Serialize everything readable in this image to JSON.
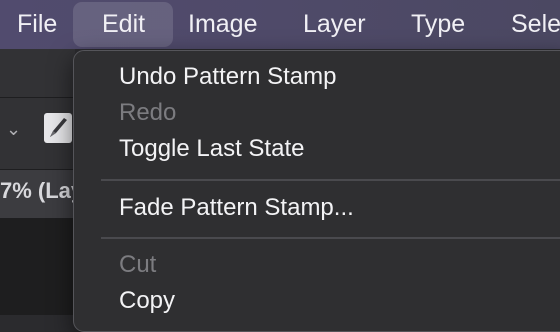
{
  "menubar": {
    "items": [
      "File",
      "Edit",
      "Image",
      "Layer",
      "Type",
      "Sele"
    ]
  },
  "document": {
    "tab_label": "7% (Lay"
  },
  "edit_menu": {
    "items": [
      {
        "label": "Undo Pattern Stamp",
        "enabled": true,
        "shortcut": ""
      },
      {
        "label": "Redo",
        "enabled": false,
        "shortcut": "⇧"
      },
      {
        "label": "Toggle Last State",
        "enabled": true,
        "shortcut": "⌥"
      },
      {
        "label": "Fade Pattern Stamp...",
        "enabled": true,
        "shortcut": "⇧"
      },
      {
        "label": "Cut",
        "enabled": false,
        "shortcut": ""
      },
      {
        "label": "Copy",
        "enabled": true,
        "shortcut": ""
      }
    ]
  },
  "icons": {
    "chevron": "chevron-down-icon",
    "brush": "brush-tool-icon"
  }
}
